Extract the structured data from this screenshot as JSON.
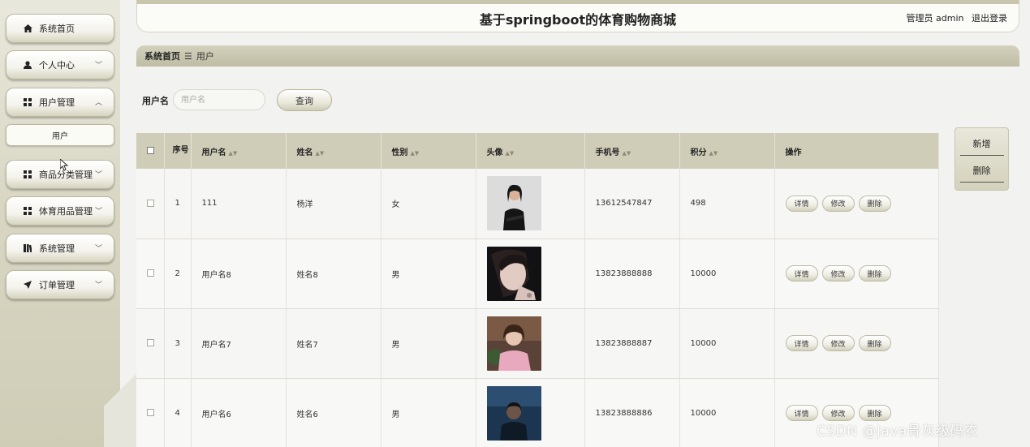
{
  "header": {
    "title": "基于springboot的体育购物商城",
    "user_label": "管理员 admin",
    "logout": "退出登录"
  },
  "sidebar": {
    "items": [
      {
        "label": "系统首页",
        "icon": "home-icon"
      },
      {
        "label": "个人中心",
        "icon": "user-icon",
        "expandable": true
      },
      {
        "label": "用户管理",
        "icon": "grid-icon",
        "expandable": true,
        "expanded": true
      },
      {
        "label": "商品分类管理",
        "icon": "grid-icon",
        "expandable": true
      },
      {
        "label": "体育用品管理",
        "icon": "grid-icon",
        "expandable": true
      },
      {
        "label": "系统管理",
        "icon": "book-icon",
        "expandable": true
      },
      {
        "label": "订单管理",
        "icon": "send-icon",
        "expandable": true
      }
    ],
    "subitem": "用户"
  },
  "breadcrumb": {
    "home": "系统首页",
    "separator": "☰",
    "current": "用户"
  },
  "search": {
    "label": "用户名",
    "placeholder": "用户名",
    "button": "查询"
  },
  "actions": {
    "add": "新增",
    "delete": "删除"
  },
  "table": {
    "columns": [
      "序号",
      "用户名",
      "姓名",
      "性别",
      "头像",
      "手机号",
      "积分",
      "操作"
    ],
    "rows": [
      {
        "index": "1",
        "username": "111",
        "name": "杨洋",
        "gender": "女",
        "phone": "13612547847",
        "points": "498",
        "avatar_style": "woman-black-outfit-portrait"
      },
      {
        "index": "2",
        "username": "用户名8",
        "name": "姓名8",
        "gender": "男",
        "phone": "13823888888",
        "points": "10000",
        "avatar_style": "woman-closeup-dark-background"
      },
      {
        "index": "3",
        "username": "用户名7",
        "name": "姓名7",
        "gender": "男",
        "phone": "13823888887",
        "points": "10000",
        "avatar_style": "girl-pink-dress-outdoor"
      },
      {
        "index": "4",
        "username": "用户名6",
        "name": "姓名6",
        "gender": "男",
        "phone": "13823888886",
        "points": "10000",
        "avatar_style": "man-dark-blue-night"
      }
    ],
    "row_buttons": {
      "detail": "详情",
      "edit": "修改",
      "delete": "删除"
    }
  },
  "watermark": "CSDN @Java骨灰级码农",
  "colors": {
    "theme": "#cfcdb8",
    "sidebar": "#d9d7c4",
    "background": "#f2f2f0"
  }
}
